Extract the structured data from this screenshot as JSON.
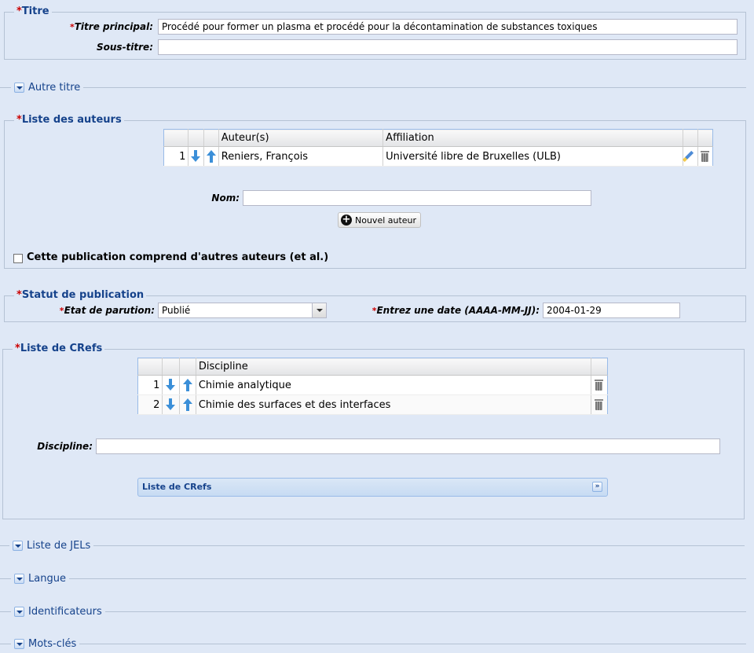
{
  "titre": {
    "legend": "Titre",
    "titre_principal_label": "Titre principal:",
    "titre_principal_value": "Procédé pour former un plasma et procédé pour la décontamination de substances toxiques",
    "sous_titre_label": "Sous-titre:",
    "sous_titre_value": ""
  },
  "autre_titre": {
    "label": "Autre titre"
  },
  "auteurs": {
    "legend": "Liste des auteurs",
    "columns": [
      "Auteur(s)",
      "Affiliation"
    ],
    "rows": [
      {
        "num": "1",
        "auteur": "Reniers, François",
        "affiliation": "Université libre de Bruxelles (ULB)"
      }
    ],
    "nom_label": "Nom:",
    "nom_value": "",
    "nouvel_auteur_button": "Nouvel auteur",
    "et_al_label": "Cette publication comprend d'autres auteurs (et al.)"
  },
  "statut": {
    "legend": "Statut de publication",
    "etat_label": "Etat de parution:",
    "etat_value": "Publié",
    "date_label": "Entrez une date (AAAA-MM-JJ):",
    "date_value": "2004-01-29"
  },
  "crefs": {
    "legend": "Liste de CRefs",
    "column": "Discipline",
    "rows": [
      {
        "num": "1",
        "discipline": "Chimie analytique"
      },
      {
        "num": "2",
        "discipline": "Chimie des surfaces et des interfaces"
      }
    ],
    "discipline_label": "Discipline:",
    "discipline_value": "",
    "panel_title": "Liste de CRefs"
  },
  "collapsed_sections": {
    "jels": "Liste de JELs",
    "langue": "Langue",
    "identificateurs": "Identificateurs",
    "mots_cles": "Mots-clés"
  },
  "required_marker": "*",
  "colors": {
    "accent": "#15428b",
    "required": "#cc0000",
    "background": "#dfe8f6",
    "arrow": "#3b8fd8"
  }
}
